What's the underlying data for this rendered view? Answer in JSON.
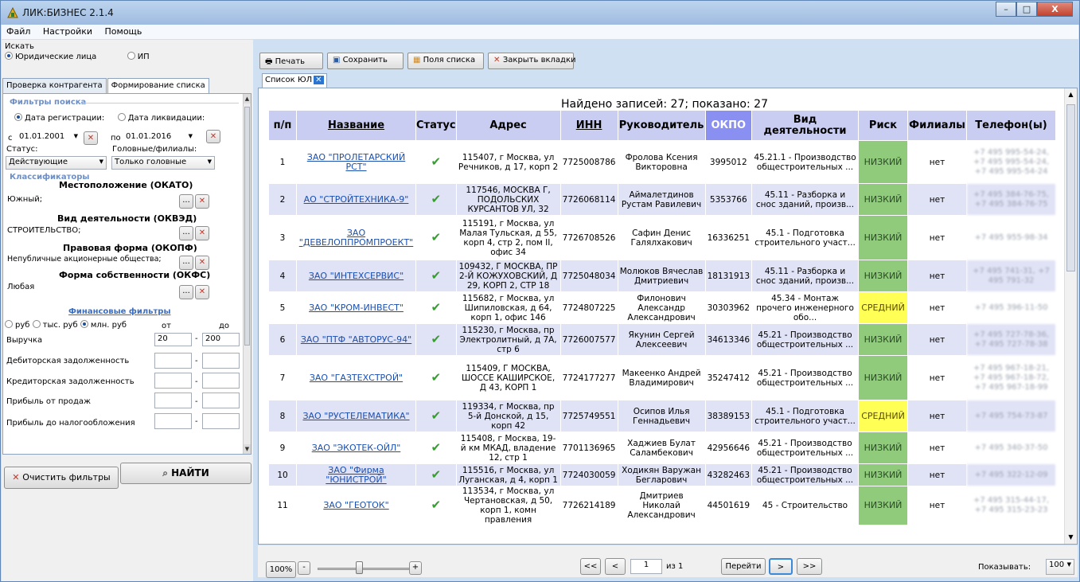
{
  "window": {
    "title": "ЛИК:БИЗНЕС 2.1.4",
    "min": "–",
    "max": "□",
    "close": "X"
  },
  "menu": [
    "Файл",
    "Настройки",
    "Помощь"
  ],
  "search": {
    "label": "Искать",
    "opt1": "Юридические лица",
    "opt2": "ИП"
  },
  "tabs": [
    "Проверка контрагента",
    "Формирование списка"
  ],
  "filters": {
    "header": "Фильтры поиска",
    "date_reg": "Дата регистрации:",
    "date_liq": "Дата ликвидации:",
    "from_label": "с",
    "from_value": "01.01.2001",
    "to_label": "по",
    "to_value": "01.01.2016",
    "status_label": "Статус:",
    "status_value": "Действующие",
    "branch_label": "Головные/филиалы:",
    "branch_value": "Только головные",
    "class_header": "Классификаторы",
    "okato_label": "Местоположение (ОКАТО)",
    "okato_value": "Южный;",
    "okved_label": "Вид деятельности (ОКВЭД)",
    "okved_value": "СТРОИТЕЛЬСТВО;",
    "okopf_label": "Правовая форма (ОКОПФ)",
    "okopf_value": "Непубличные акционерные общества;",
    "okfs_label": "Форма собственности (ОКФС)",
    "okfs_value": "Любая",
    "fin_header": "Финансовые фильтры",
    "units": [
      "руб",
      "тыс. руб",
      "млн. руб"
    ],
    "from": "от",
    "to": "до",
    "revenue": "Выручка",
    "revenue_from": "20",
    "revenue_to": "200",
    "receivable": "Дебиторская задолженность",
    "payable": "Кредиторская задолженность",
    "sales_profit": "Прибыль от продаж",
    "pretax_profit": "Прибыль до налогообложения",
    "dots": "...",
    "x": "✕",
    "dash": "-"
  },
  "clear_btn": "Очистить фильтры",
  "find_btn": "НАЙТИ",
  "toolbar": {
    "print": "Печать",
    "save": "Сохранить",
    "fields": "Поля списка",
    "close_tabs": "Закрыть вкладки"
  },
  "doc_tab": "Список ЮЛ",
  "found": "Найдено записей: 27; показано: 27",
  "columns": [
    "п/п",
    "Название",
    "Статус",
    "Адрес",
    "ИНН",
    "Руководитель",
    "ОКПО",
    "Вид деятельности",
    "Риск",
    "Филиалы",
    "Телефон(ы)"
  ],
  "rows": [
    {
      "n": "1",
      "name": "ЗАО \"ПРОЛЕТАРСКИЙ РСТ\"",
      "addr": "115407, г Москва, ул Речников, д 17, корп 2",
      "inn": "7725008786",
      "head": "Фролова Ксения Викторовна",
      "okpo": "3995012",
      "act": "45.21.1 - Производство общестроительных ...",
      "risk": "НИЗКИЙ",
      "br": "нет",
      "tel": "+7 495 995-54-24, +7 495 995-54-24, +7 495 995-54-24"
    },
    {
      "n": "2",
      "name": "АО \"СТРОЙТЕХНИКА-9\"",
      "addr": "117546, МОСКВА Г, ПОДОЛЬСКИХ КУРСАНТОВ УЛ, 32",
      "inn": "7726068114",
      "head": "Аймалетдинов Рустам Равилевич",
      "okpo": "5353766",
      "act": "45.11 - Разборка и снос зданий, произв...",
      "risk": "НИЗКИЙ",
      "br": "нет",
      "tel": "+7 495 384-76-75, +7 495 384-76-75"
    },
    {
      "n": "3",
      "name": "ЗАО \"ДЕВЕЛОППРОМПРОЕКТ\"",
      "addr": "115191, г Москва, ул Малая Тульская, д 55, корп 4, стр 2, пом II, офис 34",
      "inn": "7726708526",
      "head": "Сафин Денис Галялхакович",
      "okpo": "16336251",
      "act": "45.1 - Подготовка строительного участ...",
      "risk": "НИЗКИЙ",
      "br": "нет",
      "tel": "+7 495 955-98-34"
    },
    {
      "n": "4",
      "name": "ЗАО \"ИНТЕХСЕРВИС\"",
      "addr": "109432, Г МОСКВА, ПР 2-Й КОЖУХОВСКИЙ, Д 29, КОРП 2, СТР 18",
      "inn": "7725048034",
      "head": "Молюков Вячеслав Дмитриевич",
      "okpo": "18131913",
      "act": "45.11 - Разборка и снос зданий, произв...",
      "risk": "НИЗКИЙ",
      "br": "нет",
      "tel": "+7 495 741-31, +7 495 791-32"
    },
    {
      "n": "5",
      "name": "ЗАО \"КРОМ-ИНВЕСТ\"",
      "addr": "115682, г Москва, ул Шипиловская, д 64, корп 1, офис 146",
      "inn": "7724807225",
      "head": "Филонович Александр Александрович",
      "okpo": "30303962",
      "act": "45.34 - Монтаж прочего инженерного обо...",
      "risk": "СРЕДНИЙ",
      "br": "нет",
      "tel": "+7 495 396-11-50"
    },
    {
      "n": "6",
      "name": "ЗАО \"ПТФ \"АВТОРУС-94\"",
      "addr": "115230, г Москва, пр Электролитный, д 7А, стр 6",
      "inn": "7726007577",
      "head": "Якунин Сергей Алексеевич",
      "okpo": "34613346",
      "act": "45.21 - Производство общестроительных ...",
      "risk": "НИЗКИЙ",
      "br": "нет",
      "tel": "+7 495 727-78-36, +7 495 727-78-38"
    },
    {
      "n": "7",
      "name": "ЗАО \"ГАЗТЕХСТРОЙ\"",
      "addr": "115409, Г МОСКВА, ШОССЕ КАШИРСКОЕ, Д 43, КОРП 1",
      "inn": "7724177277",
      "head": "Макеенко Андрей Владимирович",
      "okpo": "35247412",
      "act": "45.21 - Производство общестроительных ...",
      "risk": "НИЗКИЙ",
      "br": "нет",
      "tel": "+7 495 967-18-21, +7 495 967-18-72, +7 495 967-18-99"
    },
    {
      "n": "8",
      "name": "ЗАО \"РУСТЕЛЕМАТИКА\"",
      "addr": "119334, г Москва, пр 5-й Донской, д 15, корп 42",
      "inn": "7725749551",
      "head": "Осипов Илья Геннадьевич",
      "okpo": "38389153",
      "act": "45.1 - Подготовка строительного участ...",
      "risk": "СРЕДНИЙ",
      "br": "нет",
      "tel": "+7 495 754-73-87"
    },
    {
      "n": "9",
      "name": "ЗАО \"ЭКОТЕК-ОЙЛ\"",
      "addr": "115408, г Москва, 19-й км МКАД, владение 12, стр 1",
      "inn": "7701136965",
      "head": "Хаджиев Булат Саламбекович",
      "okpo": "42956646",
      "act": "45.21 - Производство общестроительных ...",
      "risk": "НИЗКИЙ",
      "br": "нет",
      "tel": "+7 495 340-37-50"
    },
    {
      "n": "10",
      "name": "ЗАО \"Фирма \"ЮНИСТРОЙ\"",
      "addr": "115516, г Москва, ул Луганская, д 4, корп 1",
      "inn": "7724030059",
      "head": "Ходикян Варужан Бегларович",
      "okpo": "43282463",
      "act": "45.21 - Производство общестроительных ...",
      "risk": "НИЗКИЙ",
      "br": "нет",
      "tel": "+7 495 322-12-09"
    },
    {
      "n": "11",
      "name": "ЗАО \"ГЕОТОК\"",
      "addr": "113534, г Москва, ул Чертановская, д 50, корп 1, комн правления",
      "inn": "7726214189",
      "head": "Дмитриев Николай Александрович",
      "okpo": "44501619",
      "act": "45 - Строительство",
      "risk": "НИЗКИЙ",
      "br": "нет",
      "tel": "+7 495 315-44-17, +7 495 315-23-23"
    }
  ],
  "pager": {
    "zoom": "100%",
    "minus": "-",
    "plus": "+",
    "first": "<<",
    "prev": "<",
    "page": "1",
    "of": "из 1",
    "go": "Перейти",
    "next": ">",
    "last": ">>",
    "show_label": "Показывать:",
    "show_value": "100"
  },
  "colors": {
    "okpo_header": "#8a8ff2",
    "risk_low": "#8fcb7b",
    "risk_mid": "#ffff55"
  }
}
